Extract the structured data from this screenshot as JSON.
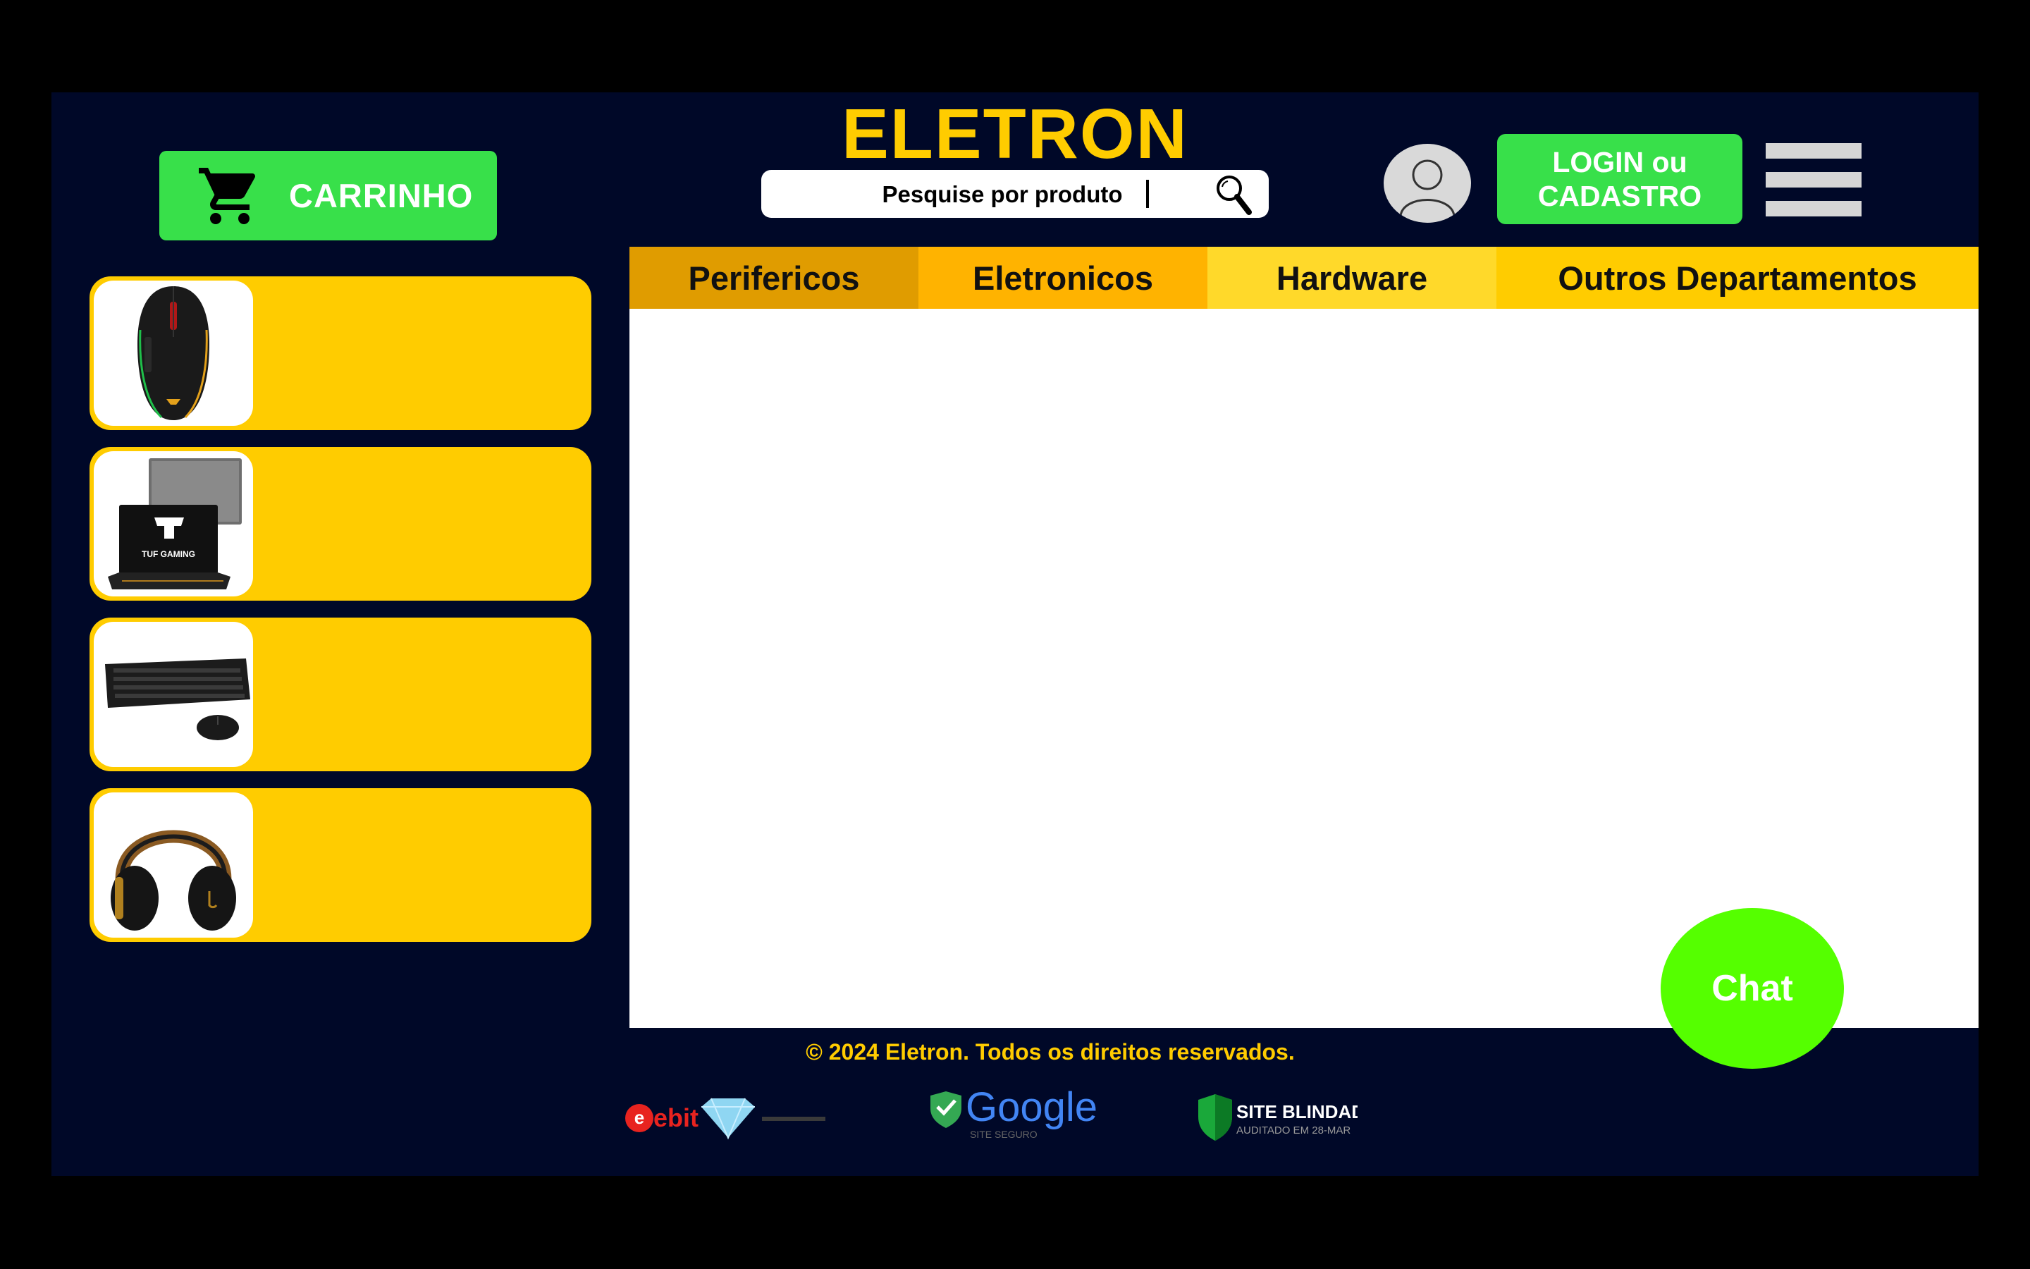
{
  "header": {
    "brand": "ELETRON",
    "cart_label": "CARRINHO",
    "search": {
      "placeholder": "Pesquise por produto"
    },
    "login_line1": "LOGIN ou",
    "login_line2": "CADASTRO"
  },
  "tabs": [
    {
      "label": "Perifericos"
    },
    {
      "label": "Eletronicos"
    },
    {
      "label": "Hardware"
    },
    {
      "label": "Outros Departamentos"
    }
  ],
  "sidebar": {
    "products": [
      {
        "image": "gaming-mouse"
      },
      {
        "image": "tuf-gaming-laptop",
        "image_text": "TUF GAMING"
      },
      {
        "image": "keyboard-and-mouse"
      },
      {
        "image": "headphones"
      }
    ]
  },
  "chat": {
    "label": "Chat"
  },
  "footer": {
    "copyright": "© 2024 Eletron. Todos os direitos reservados.",
    "seals": {
      "ebit": "ebit",
      "google": "Google",
      "google_sub": "SITE SEGURO",
      "blindado": "SITE BLINDADO",
      "blindado_sub": "AUDITADO EM 28-MAR"
    }
  },
  "colors": {
    "background": "#000828",
    "accent_yellow": "#ffcc00",
    "button_green": "#38e04a",
    "chat_green": "#55ff00"
  },
  "icons": [
    "cart-icon",
    "search-icon",
    "user-icon",
    "menu-icon"
  ]
}
